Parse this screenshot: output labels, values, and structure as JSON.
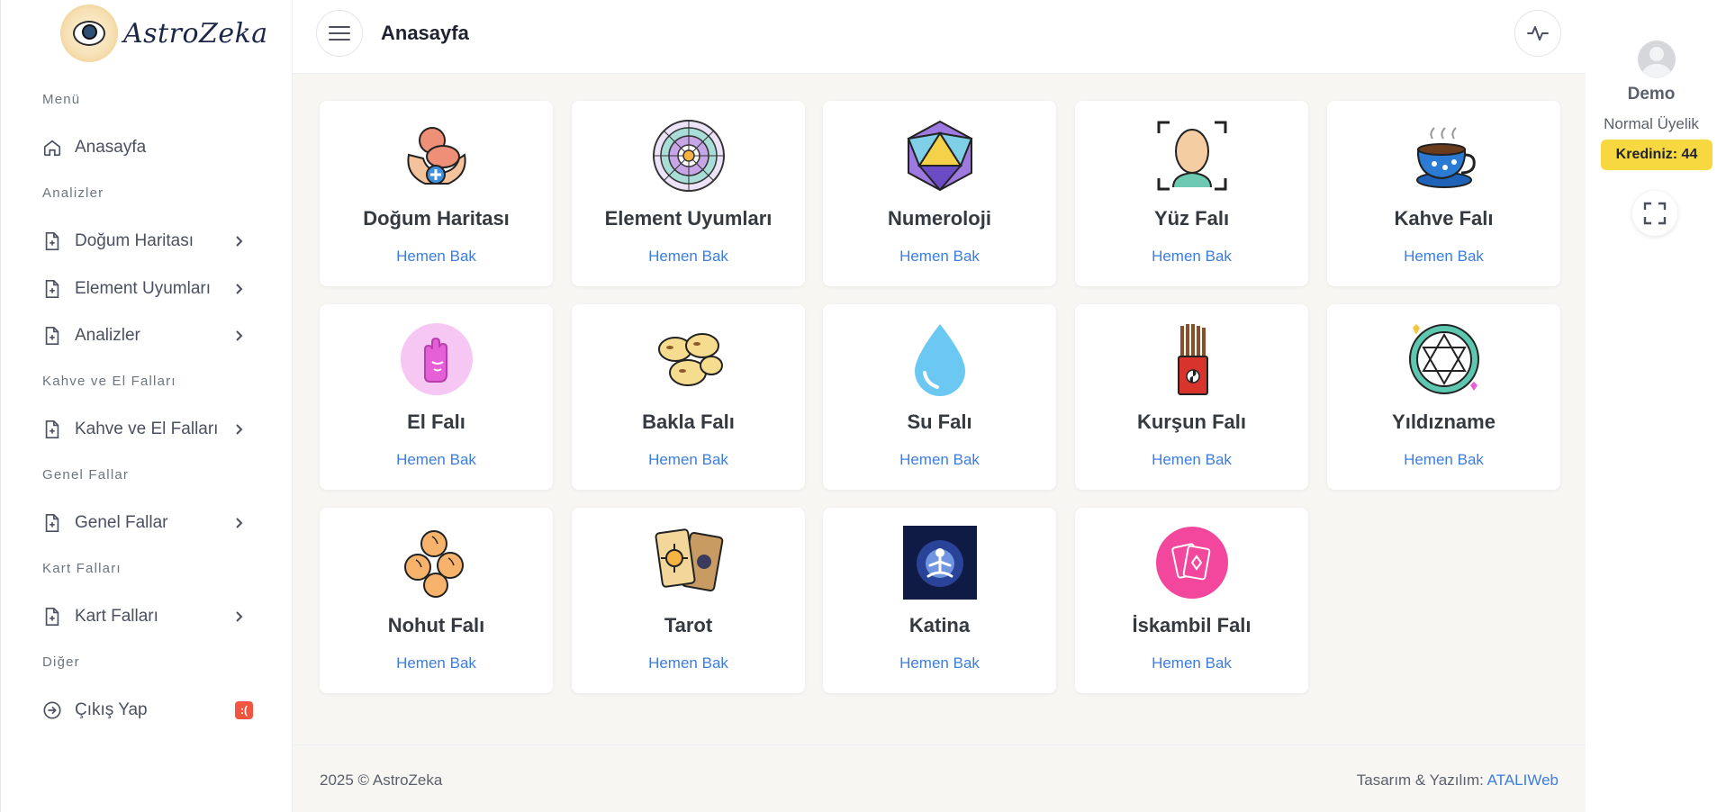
{
  "brand": {
    "name": "AstroZeka"
  },
  "sidebar": {
    "sections": [
      {
        "heading": "Menü",
        "items": [
          {
            "label": "Anasayfa",
            "icon": "home-icon",
            "arrow": false
          }
        ]
      },
      {
        "heading": "Analizler",
        "items": [
          {
            "label": "Doğum Haritası",
            "icon": "file-plus-icon",
            "arrow": true
          },
          {
            "label": "Element Uyumları",
            "icon": "file-plus-icon",
            "arrow": true
          },
          {
            "label": "Analizler",
            "icon": "file-plus-icon",
            "arrow": true
          }
        ]
      },
      {
        "heading": "Kahve ve El Falları",
        "items": [
          {
            "label": "Kahve ve El Falları",
            "icon": "file-plus-icon",
            "arrow": true
          }
        ]
      },
      {
        "heading": "Genel Fallar",
        "items": [
          {
            "label": "Genel Fallar",
            "icon": "file-plus-icon",
            "arrow": true
          }
        ]
      },
      {
        "heading": "Kart Falları",
        "items": [
          {
            "label": "Kart Falları",
            "icon": "file-plus-icon",
            "arrow": true
          }
        ]
      },
      {
        "heading": "Diğer",
        "items": [
          {
            "label": "Çıkış Yap",
            "icon": "logout-icon",
            "arrow": false,
            "badge": ":("
          }
        ]
      }
    ]
  },
  "header": {
    "title": "Anasayfa"
  },
  "cards": [
    {
      "title": "Doğum Haritası",
      "link": "Hemen Bak",
      "icon": "baby-hands-icon"
    },
    {
      "title": "Element Uyumları",
      "link": "Hemen Bak",
      "icon": "zodiac-wheel-icon"
    },
    {
      "title": "Numeroloji",
      "link": "Hemen Bak",
      "icon": "d20-dice-icon"
    },
    {
      "title": "Yüz Falı",
      "link": "Hemen Bak",
      "icon": "face-scan-icon"
    },
    {
      "title": "Kahve Falı",
      "link": "Hemen Bak",
      "icon": "coffee-cup-icon"
    },
    {
      "title": "El Falı",
      "link": "Hemen Bak",
      "icon": "palm-icon"
    },
    {
      "title": "Bakla Falı",
      "link": "Hemen Bak",
      "icon": "beans-icon"
    },
    {
      "title": "Su Falı",
      "link": "Hemen Bak",
      "icon": "water-drop-icon"
    },
    {
      "title": "Kurşun Falı",
      "link": "Hemen Bak",
      "icon": "incense-sticks-icon"
    },
    {
      "title": "Yıldızname",
      "link": "Hemen Bak",
      "icon": "star-of-david-icon"
    },
    {
      "title": "Nohut Falı",
      "link": "Hemen Bak",
      "icon": "chickpeas-icon"
    },
    {
      "title": "Tarot",
      "link": "Hemen Bak",
      "icon": "tarot-cards-icon"
    },
    {
      "title": "Katina",
      "link": "Hemen Bak",
      "icon": "meditation-icon"
    },
    {
      "title": "İskambil Falı",
      "link": "Hemen Bak",
      "icon": "playing-cards-icon"
    }
  ],
  "footer": {
    "copyright": "2025 © AstroZeka",
    "credit_prefix": "Tasarım & Yazılım:",
    "credit_link": "ATALIWeb"
  },
  "user": {
    "name": "Demo",
    "role": "Normal Üyelik",
    "credit": "Krediniz: 44"
  },
  "colors": {
    "accent": "#3b7de0",
    "credit_bg": "#f8d841",
    "badge_red": "#f1543f",
    "main_bg": "#f8f6f3"
  }
}
